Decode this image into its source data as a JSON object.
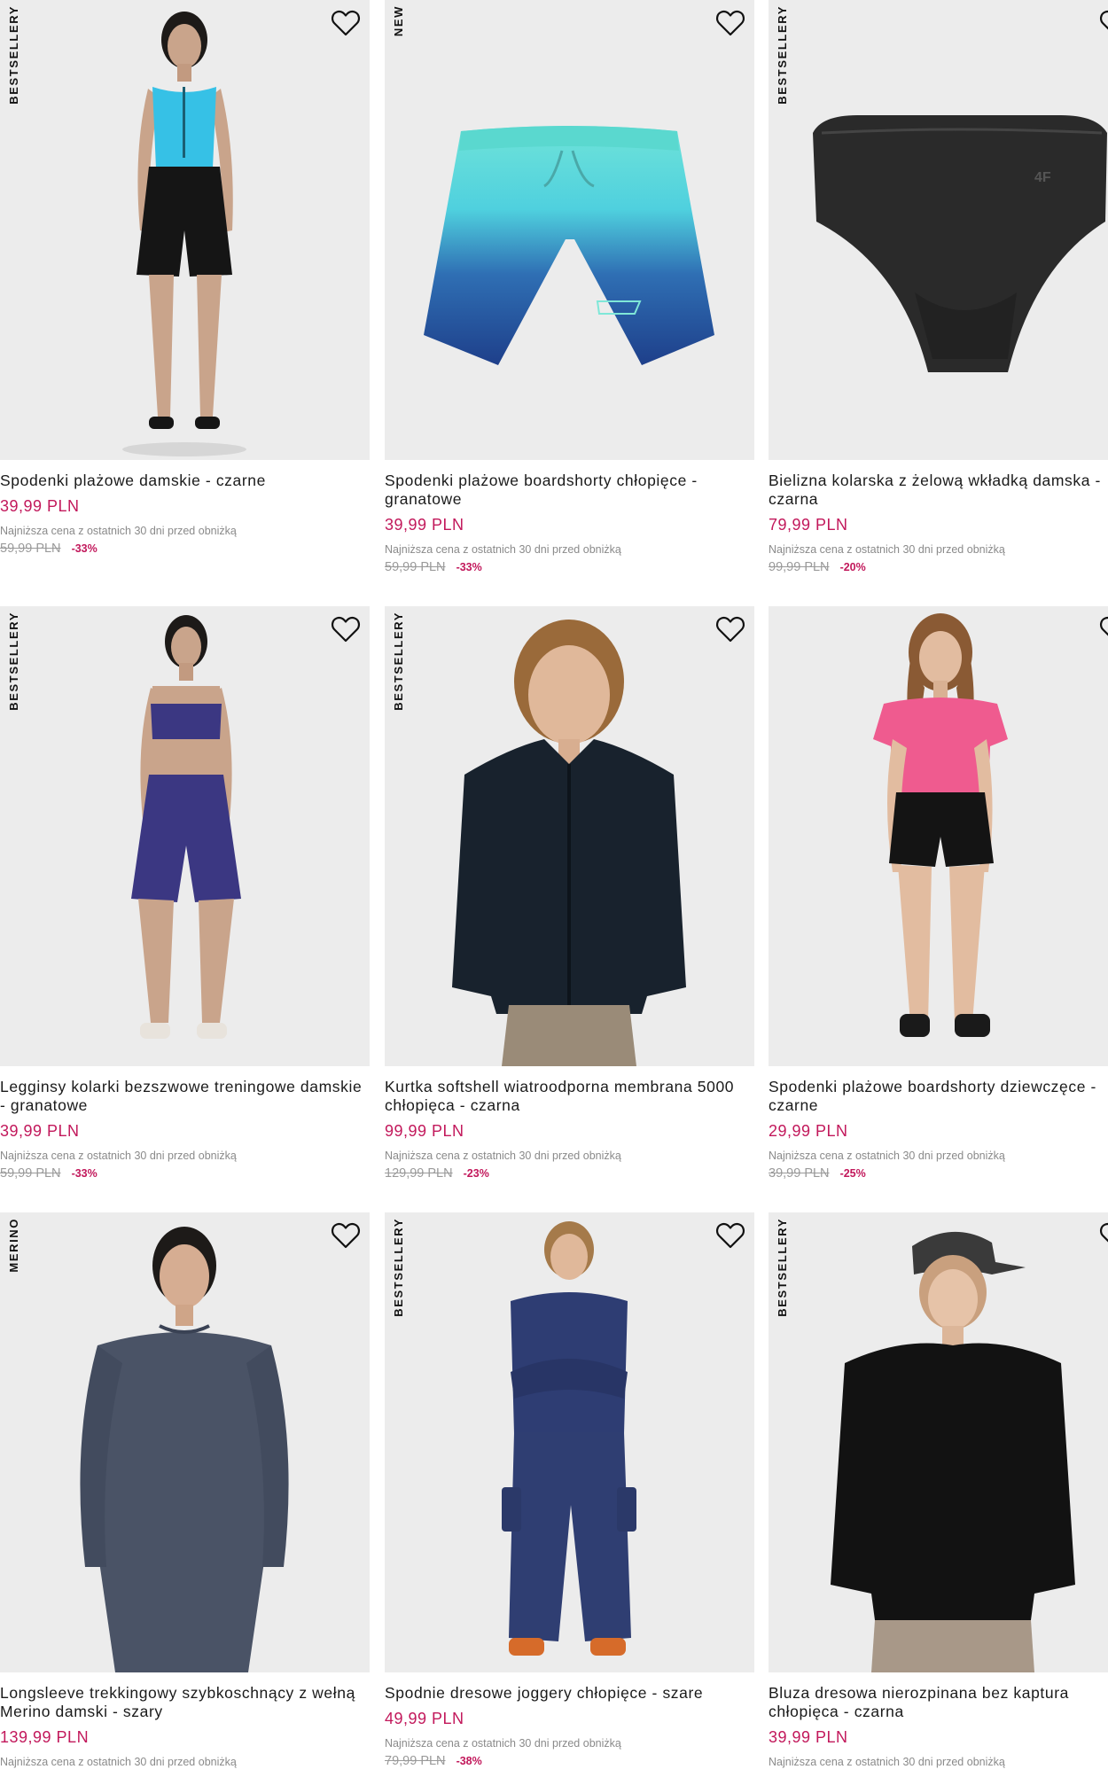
{
  "products": [
    {
      "badge": "BESTSELLERY",
      "name": "Spodenki plażowe damskie - czarne",
      "price": "39,99 PLN",
      "lowest_label": "Najniższa cena z ostatnich 30 dni przed obniżką",
      "old_price": "59,99 PLN",
      "discount": "-33%",
      "favorite_icon": "heart-outline-icon",
      "image": "woman-blue-top-black-shorts"
    },
    {
      "badge": "NEW",
      "name": "Spodenki plażowe boardshorty chłopięce - granatowe",
      "price": "39,99 PLN",
      "lowest_label": "Najniższa cena z ostatnich 30 dni przed obniżką",
      "old_price": "59,99 PLN",
      "discount": "-33%",
      "favorite_icon": "heart-outline-icon",
      "image": "gradient-boardshorts"
    },
    {
      "badge": "BESTSELLERY",
      "name": "Bielizna kolarska z żelową wkładką damska - czarna",
      "price": "79,99 PLN",
      "lowest_label": "Najniższa cena z ostatnich 30 dni przed obniżką",
      "old_price": "99,99 PLN",
      "discount": "-20%",
      "favorite_icon": "heart-outline-icon",
      "image": "black-cycling-brief"
    },
    {
      "badge": "BESTSELLERY",
      "name": "Legginsy kolarki bezszwowe treningowe damskie - granatowe",
      "price": "39,99 PLN",
      "lowest_label": "Najniższa cena z ostatnich 30 dni przed obniżką",
      "old_price": "59,99 PLN",
      "discount": "-33%",
      "favorite_icon": "heart-outline-icon",
      "image": "woman-navy-bra-shorts"
    },
    {
      "badge": "BESTSELLERY",
      "name": "Kurtka softshell wiatroodporna membrana 5000 chłopięca - czarna",
      "price": "99,99 PLN",
      "lowest_label": "Najniższa cena z ostatnich 30 dni przed obniżką",
      "old_price": "129,99 PLN",
      "discount": "-23%",
      "favorite_icon": "heart-outline-icon",
      "image": "boy-black-softshell"
    },
    {
      "badge": "",
      "name": "Spodenki plażowe boardshorty dziewczęce - czarne",
      "price": "29,99 PLN",
      "lowest_label": "Najniższa cena z ostatnich 30 dni przed obniżką",
      "old_price": "39,99 PLN",
      "discount": "-25%",
      "favorite_icon": "heart-outline-icon",
      "image": "girl-pink-top-black-shorts"
    },
    {
      "badge": "MERINO",
      "name": "Longsleeve trekkingowy szybkoschnący z wełną Merino damski - szary",
      "price": "139,99 PLN",
      "lowest_label": "Najniższa cena z ostatnich 30 dni przed obniżką",
      "old_price": "",
      "discount": "",
      "favorite_icon": "heart-outline-icon",
      "image": "woman-grey-longsleeve"
    },
    {
      "badge": "BESTSELLERY",
      "name": "Spodnie dresowe joggery chłopięce - szare",
      "price": "49,99 PLN",
      "lowest_label": "Najniższa cena z ostatnich 30 dni przed obniżką",
      "old_price": "79,99 PLN",
      "discount": "-38%",
      "favorite_icon": "heart-outline-icon",
      "image": "boy-navy-tracksuit"
    },
    {
      "badge": "BESTSELLERY",
      "name": "Bluza dresowa nierozpinana bez kaptura chłopięca - czarna",
      "price": "39,99 PLN",
      "lowest_label": "Najniższa cena z ostatnich 30 dni przed obniżką",
      "old_price": "",
      "discount": "",
      "favorite_icon": "heart-outline-icon",
      "image": "boy-cap-black-sweatshirt"
    }
  ],
  "colors": {
    "price": "#c2185b",
    "image_bg": "#ececec",
    "text": "#1a1a1a",
    "muted": "#8a8a8a"
  }
}
